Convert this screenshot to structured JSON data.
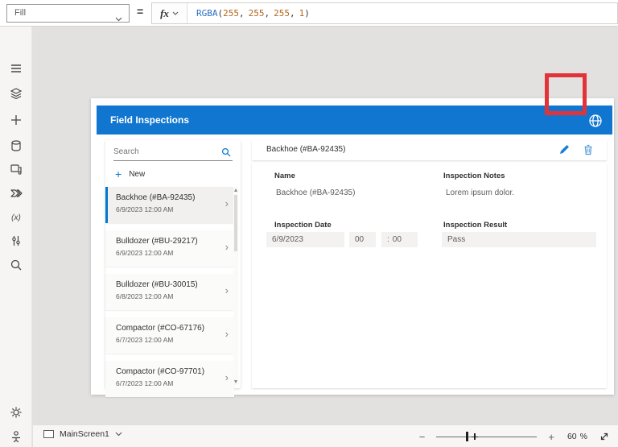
{
  "formula_bar": {
    "property_selector": {
      "value": "Fill"
    },
    "equals_sign": "=",
    "fx_label": "fx",
    "formula_tokens": {
      "fn": "RGBA",
      "open": "(",
      "n1": "255",
      "c1": ",",
      "n2": "255",
      "c2": ",",
      "n3": "255",
      "c3": ",",
      "n4": "1",
      "close": ")"
    }
  },
  "sidebar": {
    "icons": [
      "hamburger-menu",
      "tree-view",
      "insert-plus",
      "data",
      "media",
      "power-automate",
      "variables",
      "advanced-tools",
      "search"
    ],
    "bottom_icons": [
      "settings-gear",
      "accessibility-person"
    ]
  },
  "app": {
    "header": {
      "title": "Field Inspections",
      "icon": "globe"
    },
    "annotation": {
      "type": "red-highlight-rectangle",
      "target": "globe-icon",
      "color": "#e23438"
    },
    "list_panel": {
      "search_placeholder": "Search",
      "new_button": "New",
      "items": [
        {
          "title": "Backhoe (#BA-92435)",
          "date": "6/9/2023 12:00 AM",
          "selected": true
        },
        {
          "title": "Bulldozer (#BU-29217)",
          "date": "6/9/2023 12:00 AM",
          "selected": false
        },
        {
          "title": "Bulldozer (#BU-30015)",
          "date": "6/8/2023 12:00 AM",
          "selected": false
        },
        {
          "title": "Compactor (#CO-67176)",
          "date": "6/7/2023 12:00 AM",
          "selected": false
        },
        {
          "title": "Compactor (#CO-97701)",
          "date": "6/7/2023 12:00 AM",
          "selected": false
        }
      ]
    },
    "detail": {
      "title": "Backhoe (#BA-92435)",
      "actions": [
        "edit-pencil",
        "delete-trash"
      ],
      "fields": {
        "name": {
          "label": "Name",
          "value": "Backhoe (#BA-92435)"
        },
        "notes": {
          "label": "Inspection Notes",
          "value": "Lorem ipsum dolor."
        },
        "date": {
          "label": "Inspection Date",
          "value": "6/9/2023",
          "hour": "00",
          "separator": ":",
          "minute": "00"
        },
        "result": {
          "label": "Inspection Result",
          "value": "Pass"
        }
      }
    }
  },
  "bottom_bar": {
    "screen_name": "MainScreen1",
    "zoom_minus": "−",
    "zoom_plus": "+",
    "zoom_value": "60",
    "zoom_percent": "%"
  },
  "colors": {
    "accent_blue": "#0078d4",
    "header_blue": "#1176d0",
    "annotation_red": "#e23438",
    "canvas_gray": "#e2e1e0",
    "input_gray": "#f3f2f1"
  }
}
